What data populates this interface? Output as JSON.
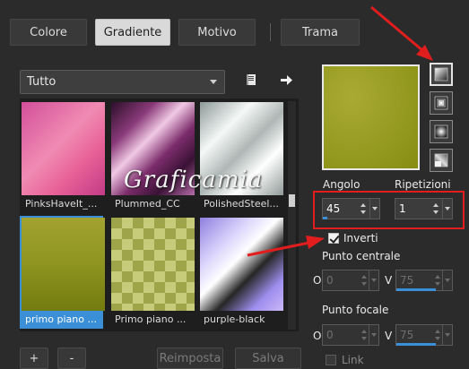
{
  "tabs": [
    {
      "label": "Colore"
    },
    {
      "label": "Gradiente"
    },
    {
      "label": "Motivo"
    },
    {
      "label": "Trama"
    }
  ],
  "category": {
    "value": "Tutto"
  },
  "gradients": [
    {
      "name": "PinksHaveIt_..."
    },
    {
      "name": "Plummed_CC"
    },
    {
      "name": "PolishedSteel..."
    },
    {
      "name": "primo piano ..."
    },
    {
      "name": "Primo piano ..."
    },
    {
      "name": "purple-black"
    }
  ],
  "buttons": {
    "add": "+",
    "remove": "-",
    "reset": "Reimposta",
    "save": "Salva"
  },
  "watermark": "Graficamia",
  "angle": {
    "label": "Angolo",
    "value": "45",
    "level": 0.125
  },
  "repeats": {
    "label": "Ripetizioni",
    "value": "1",
    "level": 0.0
  },
  "invert": {
    "label": "Inverti",
    "checked": true
  },
  "center_point": {
    "title": "Punto centrale",
    "h_label": "O",
    "h_value": "0",
    "v_label": "V",
    "v_value": "75"
  },
  "focal_point": {
    "title": "Punto focale",
    "h_label": "O",
    "h_value": "0",
    "v_label": "V",
    "v_value": "75"
  },
  "link": {
    "label": "Link",
    "checked": false
  },
  "colors": {
    "accent": "#3b8fd6",
    "highlight": "#e21d1d",
    "gradient_fg": "#9ca025"
  }
}
